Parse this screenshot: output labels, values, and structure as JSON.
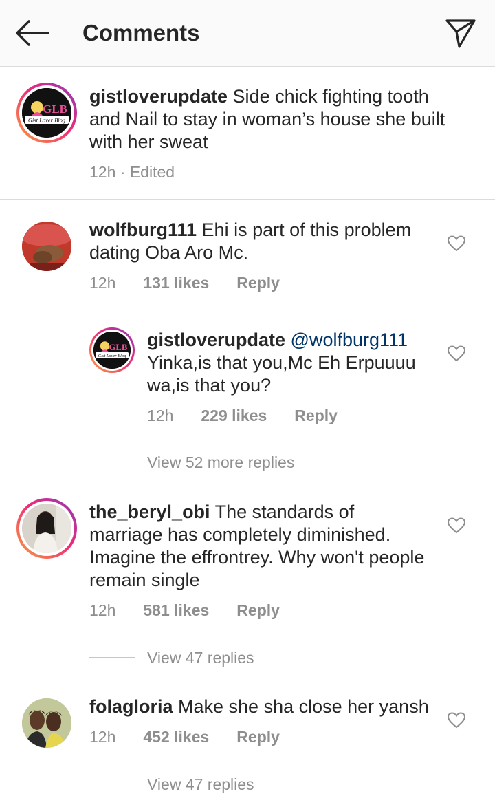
{
  "header": {
    "title": "Comments",
    "back_icon": "arrow-left-icon",
    "send_icon": "paper-plane-icon"
  },
  "caption": {
    "username": "gistloverupdate",
    "text": " Side chick fighting tooth and Nail to stay in woman’s house she built with her sweat",
    "time": "12h",
    "edited": " · Edited",
    "avatar_logo": "GLB",
    "avatar_logo_sub": "Gist Lover Blog"
  },
  "comments": [
    {
      "username": "wolfburg111",
      "text": " Ehi is part of this problem dating Oba Aro Mc.",
      "time": "12h",
      "likes": "131 likes",
      "reply": "Reply",
      "replies": [
        {
          "username": "gistloverupdate",
          "mention": " @wolfburg111",
          "text": " Yinka,is that you,Mc Eh Erpuuuu wa,is that you?",
          "time": "12h",
          "likes": "229 likes",
          "reply": "Reply",
          "avatar_logo": "GLB",
          "avatar_logo_sub": "Gist Lover Blog"
        }
      ],
      "view_more": "View 52 more replies"
    },
    {
      "username": "the_beryl_obi",
      "text": " The standards of marriage has completely diminished. Imagine the effrontrey. Why won't people remain single",
      "time": "12h",
      "likes": "581 likes",
      "reply": "Reply",
      "view_more": "View 47 replies"
    },
    {
      "username": "folagloria",
      "text": " Make she sha close her yansh",
      "time": "12h",
      "likes": "452 likes",
      "reply": "Reply",
      "view_more": "View 47 replies"
    }
  ],
  "colors": {
    "text": "#262626",
    "muted": "#8e8e8e",
    "mention": "#003569",
    "story_ring_start": "#f9a13a",
    "story_ring_end": "#8a3ab9"
  }
}
